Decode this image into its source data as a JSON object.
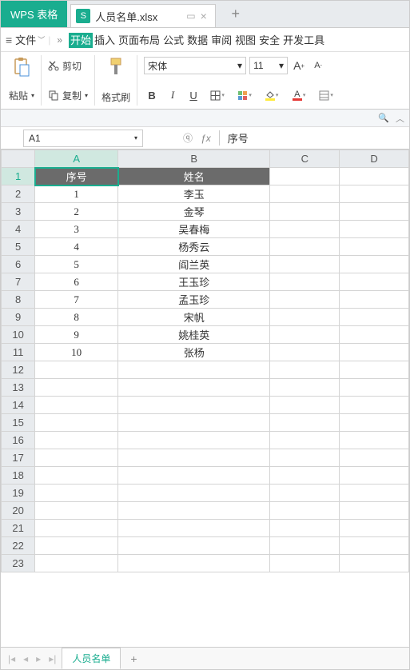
{
  "app_name": "WPS 表格",
  "tab": {
    "icon_letter": "S",
    "title": "人员名单.xlsx"
  },
  "menu": {
    "file": "文件",
    "tabs": [
      "开始",
      "插入",
      "页面布局",
      "公式",
      "数据",
      "审阅",
      "视图",
      "安全",
      "开发工具"
    ],
    "active_index": 0
  },
  "ribbon": {
    "paste": "粘贴",
    "cut": "剪切",
    "copy": "复制",
    "format_painter": "格式刷",
    "font_name": "宋体",
    "font_size": "11"
  },
  "formula_bar": {
    "namebox": "A1",
    "value": "序号"
  },
  "columns": [
    "A",
    "B",
    "C",
    "D"
  ],
  "header_row": {
    "A": "序号",
    "B": "姓名"
  },
  "data_rows": [
    {
      "A": "1",
      "B": "李玉"
    },
    {
      "A": "2",
      "B": "金琴"
    },
    {
      "A": "3",
      "B": "吴春梅"
    },
    {
      "A": "4",
      "B": "杨秀云"
    },
    {
      "A": "5",
      "B": "阎兰英"
    },
    {
      "A": "6",
      "B": "王玉珍"
    },
    {
      "A": "7",
      "B": "孟玉珍"
    },
    {
      "A": "8",
      "B": "宋帆"
    },
    {
      "A": "9",
      "B": "姚桂英"
    },
    {
      "A": "10",
      "B": "张杨"
    }
  ],
  "empty_row_count": 12,
  "sheet": {
    "active": "人员名单"
  }
}
